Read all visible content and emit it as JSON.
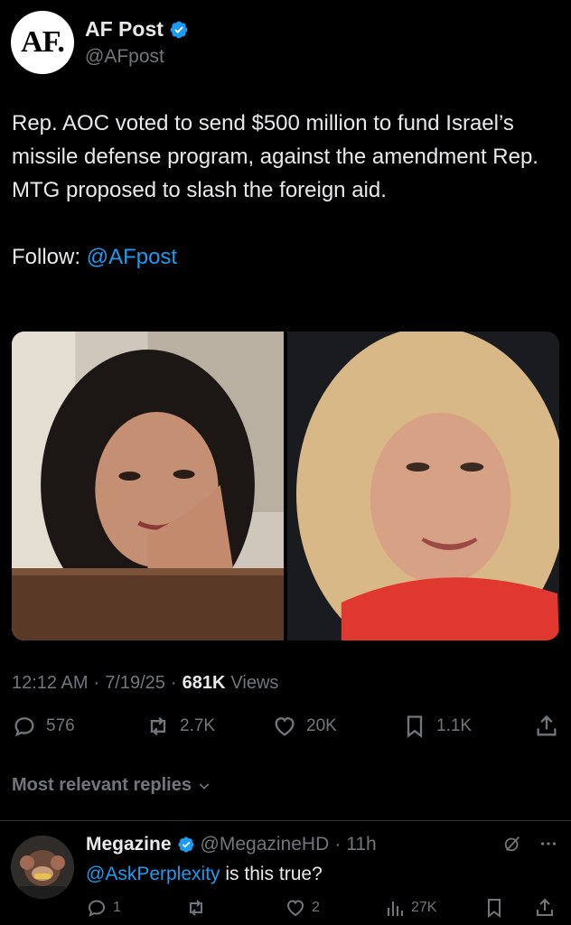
{
  "author": {
    "logo_text": "AF.",
    "display_name": "AF Post",
    "handle": "@AFpost",
    "verified_color": "#1d9bf0"
  },
  "tweet": {
    "text": "Rep. AOC voted to send $500 million to fund Israel’s missile defense program, against the amendment Rep. MTG proposed to slash the foreign aid.",
    "follow_label": "Follow:",
    "follow_mention": "@AFpost",
    "time": "12:12 AM",
    "date": "7/19/25",
    "views_count": "681K",
    "views_label": "Views"
  },
  "actions": {
    "replies": "576",
    "reposts": "2.7K",
    "likes": "20K",
    "bookmarks": "1.1K"
  },
  "replies_sort": {
    "label": "Most relevant replies"
  },
  "reply": {
    "display_name": "Megazine",
    "handle": "@MegazineHD",
    "time": "11h",
    "mention": "@AskPerplexity",
    "text": " is this true?",
    "replies": "1",
    "likes": "2",
    "views": "27K"
  },
  "colors": {
    "background": "#000000",
    "text": "#e7e9ea",
    "muted": "#71767b",
    "accent": "#1d9bf0",
    "divider": "#2f3336"
  },
  "icons": [
    "verified-badge-icon",
    "reply-icon",
    "repost-icon",
    "like-icon",
    "bookmark-icon",
    "share-icon",
    "views-icon",
    "chevron-down-icon",
    "grok-icon",
    "more-icon"
  ]
}
